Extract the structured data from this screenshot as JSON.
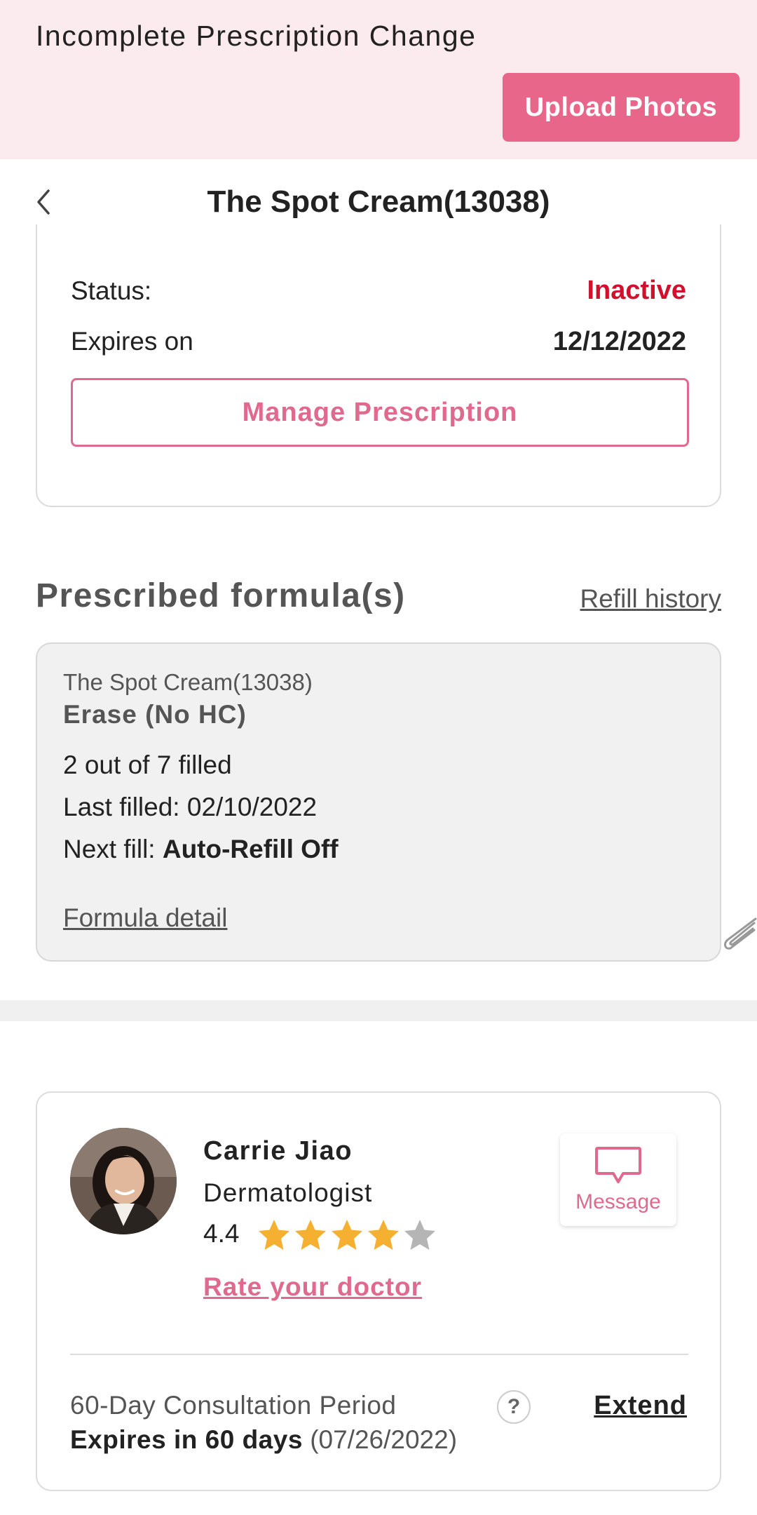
{
  "banner": {
    "title": "Incomplete Prescription Change",
    "upload_label": "Upload Photos"
  },
  "nav": {
    "title": "The Spot Cream(13038)",
    "back_icon": "chevron-left-icon"
  },
  "prescription": {
    "status_label": "Status:",
    "status_value": "Inactive",
    "expires_label": "Expires on",
    "expires_value": "12/12/2022",
    "manage_label": "Manage Prescription"
  },
  "formulas": {
    "section_title": "Prescribed formula(s)",
    "refill_history_label": "Refill history",
    "items": [
      {
        "product": "The Spot Cream(13038)",
        "name": "Erase (No HC)",
        "filled": "2 out of 7 filled",
        "last_filled": "Last filled: 02/10/2022",
        "next_fill_label": "Next fill:",
        "next_fill_value": "Auto-Refill Off",
        "detail_label": "Formula detail"
      }
    ]
  },
  "doctor": {
    "name": "Carrie Jiao",
    "specialty": "Dermatologist",
    "rating": "4.4",
    "rating_value": 4.4,
    "rating_max": 5,
    "rate_label": "Rate your doctor",
    "message_label": "Message",
    "consultation": {
      "title": "60-Day Consultation Period",
      "expires_strong": "Expires in 60 days",
      "expires_date": "(07/26/2022)",
      "extend_label": "Extend",
      "help_symbol": "?"
    }
  },
  "colors": {
    "accent": "#e8668a",
    "banner_bg": "#fcebee",
    "status_inactive": "#d0102c",
    "star_filled": "#f5b031",
    "star_empty": "#b5b5b5"
  }
}
